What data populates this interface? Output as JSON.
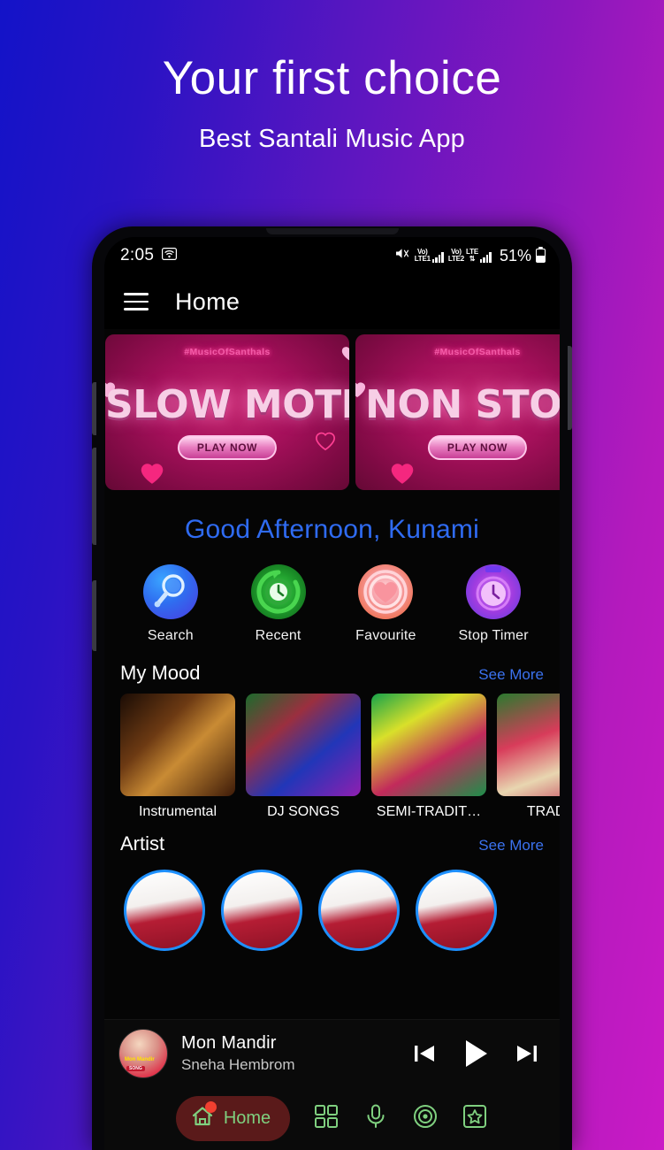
{
  "promo": {
    "title": "Your first choice",
    "subtitle": "Best Santali Music App"
  },
  "colors": {
    "bg_gradient_start": "#1313c8",
    "bg_gradient_end": "#ca1ac6",
    "greeting_blue": "#2f6bf2",
    "see_more_blue": "#3b72ef",
    "nav_green": "#7fd07f",
    "banner_pink": "#c2246d",
    "artist_ring": "#1e90ff"
  },
  "status_bar": {
    "time": "2:05",
    "wifi_icon": "wifi-icon",
    "mute_icon": "volume-mute-icon",
    "sim1_label_top": "Vo)",
    "sim1_label_bottom": "LTE1",
    "sim2_label_top": "Vo)",
    "sim2_label_bottom": "LTE2",
    "network_label": "LTE",
    "battery_percent": "51%",
    "battery_icon": "battery-icon"
  },
  "app_bar": {
    "menu_icon": "hamburger-menu-icon",
    "title": "Home"
  },
  "banners": [
    {
      "hashtag": "#MusicOfSanthals",
      "title": "SLOW MOTION",
      "play_label": "PLAY NOW"
    },
    {
      "hashtag": "#MusicOfSanthals",
      "title": "NON STOP",
      "play_label": "PLAY NOW"
    }
  ],
  "greeting": "Good Afternoon, Kunami",
  "quick_actions": [
    {
      "label": "Search",
      "icon": "search-icon"
    },
    {
      "label": "Recent",
      "icon": "recent-clock-icon"
    },
    {
      "label": "Favourite",
      "icon": "heart-icon"
    },
    {
      "label": "Stop Timer",
      "icon": "stopwatch-icon"
    }
  ],
  "my_mood": {
    "title": "My Mood",
    "see_more": "See More",
    "items": [
      {
        "label": "Instrumental"
      },
      {
        "label": "DJ SONGS"
      },
      {
        "label": "SEMI-TRADIT…"
      },
      {
        "label": "TRADITI"
      }
    ]
  },
  "artist": {
    "title": "Artist",
    "see_more": "See More",
    "items": [
      {
        "name": ""
      },
      {
        "name": ""
      },
      {
        "name": ""
      },
      {
        "name": ""
      }
    ]
  },
  "player": {
    "track_title": "Mon Mandir",
    "artist_name": "Sneha Hembrom",
    "art_tag": "Mon Mandir",
    "art_tag2": "SONG",
    "prev_icon": "skip-previous-icon",
    "play_icon": "play-icon",
    "next_icon": "skip-next-icon"
  },
  "bottom_nav": [
    {
      "label": "Home",
      "icon": "home-icon",
      "active": true
    },
    {
      "label": "",
      "icon": "grid-icon",
      "active": false
    },
    {
      "label": "",
      "icon": "microphone-icon",
      "active": false
    },
    {
      "label": "",
      "icon": "disc-icon",
      "active": false
    },
    {
      "label": "",
      "icon": "star-box-icon",
      "active": false
    }
  ]
}
